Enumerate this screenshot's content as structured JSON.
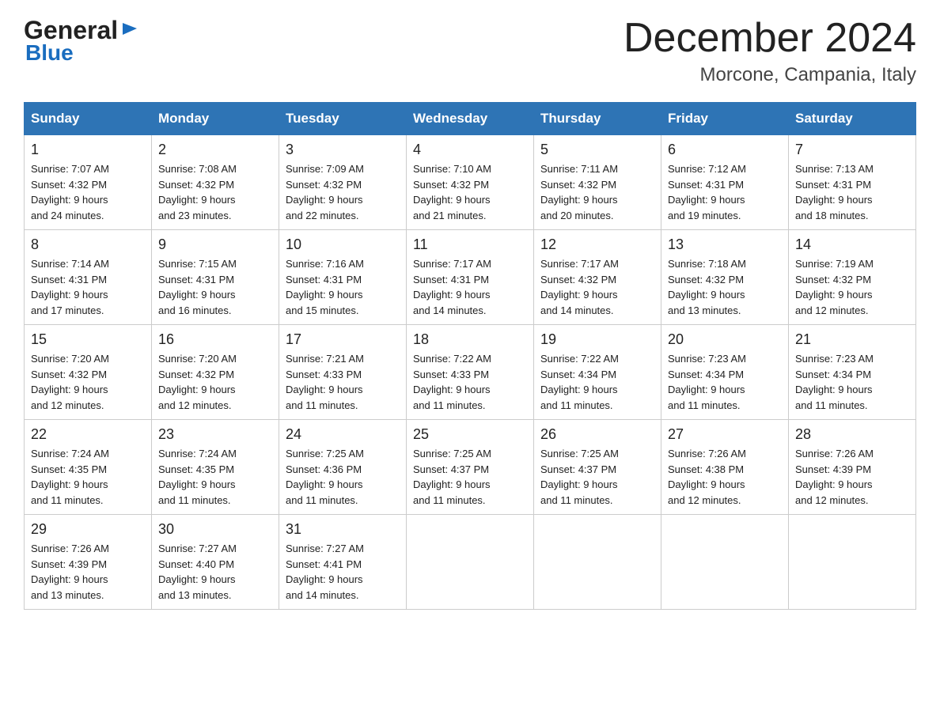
{
  "header": {
    "logo_general": "General",
    "logo_blue": "Blue",
    "month_title": "December 2024",
    "location": "Morcone, Campania, Italy"
  },
  "days_of_week": [
    "Sunday",
    "Monday",
    "Tuesday",
    "Wednesday",
    "Thursday",
    "Friday",
    "Saturday"
  ],
  "weeks": [
    [
      {
        "day": "1",
        "sunrise": "7:07 AM",
        "sunset": "4:32 PM",
        "daylight": "9 hours and 24 minutes."
      },
      {
        "day": "2",
        "sunrise": "7:08 AM",
        "sunset": "4:32 PM",
        "daylight": "9 hours and 23 minutes."
      },
      {
        "day": "3",
        "sunrise": "7:09 AM",
        "sunset": "4:32 PM",
        "daylight": "9 hours and 22 minutes."
      },
      {
        "day": "4",
        "sunrise": "7:10 AM",
        "sunset": "4:32 PM",
        "daylight": "9 hours and 21 minutes."
      },
      {
        "day": "5",
        "sunrise": "7:11 AM",
        "sunset": "4:32 PM",
        "daylight": "9 hours and 20 minutes."
      },
      {
        "day": "6",
        "sunrise": "7:12 AM",
        "sunset": "4:31 PM",
        "daylight": "9 hours and 19 minutes."
      },
      {
        "day": "7",
        "sunrise": "7:13 AM",
        "sunset": "4:31 PM",
        "daylight": "9 hours and 18 minutes."
      }
    ],
    [
      {
        "day": "8",
        "sunrise": "7:14 AM",
        "sunset": "4:31 PM",
        "daylight": "9 hours and 17 minutes."
      },
      {
        "day": "9",
        "sunrise": "7:15 AM",
        "sunset": "4:31 PM",
        "daylight": "9 hours and 16 minutes."
      },
      {
        "day": "10",
        "sunrise": "7:16 AM",
        "sunset": "4:31 PM",
        "daylight": "9 hours and 15 minutes."
      },
      {
        "day": "11",
        "sunrise": "7:17 AM",
        "sunset": "4:31 PM",
        "daylight": "9 hours and 14 minutes."
      },
      {
        "day": "12",
        "sunrise": "7:17 AM",
        "sunset": "4:32 PM",
        "daylight": "9 hours and 14 minutes."
      },
      {
        "day": "13",
        "sunrise": "7:18 AM",
        "sunset": "4:32 PM",
        "daylight": "9 hours and 13 minutes."
      },
      {
        "day": "14",
        "sunrise": "7:19 AM",
        "sunset": "4:32 PM",
        "daylight": "9 hours and 12 minutes."
      }
    ],
    [
      {
        "day": "15",
        "sunrise": "7:20 AM",
        "sunset": "4:32 PM",
        "daylight": "9 hours and 12 minutes."
      },
      {
        "day": "16",
        "sunrise": "7:20 AM",
        "sunset": "4:32 PM",
        "daylight": "9 hours and 12 minutes."
      },
      {
        "day": "17",
        "sunrise": "7:21 AM",
        "sunset": "4:33 PM",
        "daylight": "9 hours and 11 minutes."
      },
      {
        "day": "18",
        "sunrise": "7:22 AM",
        "sunset": "4:33 PM",
        "daylight": "9 hours and 11 minutes."
      },
      {
        "day": "19",
        "sunrise": "7:22 AM",
        "sunset": "4:34 PM",
        "daylight": "9 hours and 11 minutes."
      },
      {
        "day": "20",
        "sunrise": "7:23 AM",
        "sunset": "4:34 PM",
        "daylight": "9 hours and 11 minutes."
      },
      {
        "day": "21",
        "sunrise": "7:23 AM",
        "sunset": "4:34 PM",
        "daylight": "9 hours and 11 minutes."
      }
    ],
    [
      {
        "day": "22",
        "sunrise": "7:24 AM",
        "sunset": "4:35 PM",
        "daylight": "9 hours and 11 minutes."
      },
      {
        "day": "23",
        "sunrise": "7:24 AM",
        "sunset": "4:35 PM",
        "daylight": "9 hours and 11 minutes."
      },
      {
        "day": "24",
        "sunrise": "7:25 AM",
        "sunset": "4:36 PM",
        "daylight": "9 hours and 11 minutes."
      },
      {
        "day": "25",
        "sunrise": "7:25 AM",
        "sunset": "4:37 PM",
        "daylight": "9 hours and 11 minutes."
      },
      {
        "day": "26",
        "sunrise": "7:25 AM",
        "sunset": "4:37 PM",
        "daylight": "9 hours and 11 minutes."
      },
      {
        "day": "27",
        "sunrise": "7:26 AM",
        "sunset": "4:38 PM",
        "daylight": "9 hours and 12 minutes."
      },
      {
        "day": "28",
        "sunrise": "7:26 AM",
        "sunset": "4:39 PM",
        "daylight": "9 hours and 12 minutes."
      }
    ],
    [
      {
        "day": "29",
        "sunrise": "7:26 AM",
        "sunset": "4:39 PM",
        "daylight": "9 hours and 13 minutes."
      },
      {
        "day": "30",
        "sunrise": "7:27 AM",
        "sunset": "4:40 PM",
        "daylight": "9 hours and 13 minutes."
      },
      {
        "day": "31",
        "sunrise": "7:27 AM",
        "sunset": "4:41 PM",
        "daylight": "9 hours and 14 minutes."
      },
      null,
      null,
      null,
      null
    ]
  ],
  "labels": {
    "sunrise": "Sunrise:",
    "sunset": "Sunset:",
    "daylight": "Daylight:"
  }
}
